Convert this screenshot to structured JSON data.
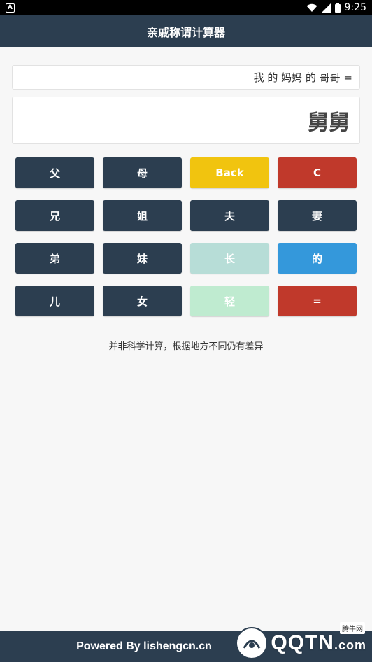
{
  "status_bar": {
    "notification_icon_letter": "A",
    "time": "9:25",
    "icons": [
      "wifi-icon",
      "signal-icon",
      "battery-icon"
    ]
  },
  "header": {
    "title": "亲戚称谓计算器"
  },
  "display": {
    "expression": "我 的 妈妈 的 哥哥 =",
    "result": "舅舅"
  },
  "keys": [
    {
      "label": "父",
      "color": "#2c3e50"
    },
    {
      "label": "母",
      "color": "#2c3e50"
    },
    {
      "label": "Back",
      "color": "#f1c40f"
    },
    {
      "label": "C",
      "color": "#c0392b"
    },
    {
      "label": "兄",
      "color": "#2c3e50"
    },
    {
      "label": "姐",
      "color": "#2c3e50"
    },
    {
      "label": "夫",
      "color": "#2c3e50"
    },
    {
      "label": "妻",
      "color": "#2c3e50"
    },
    {
      "label": "弟",
      "color": "#2c3e50"
    },
    {
      "label": "妹",
      "color": "#2c3e50"
    },
    {
      "label": "长",
      "color": "#b7ddd7"
    },
    {
      "label": "的",
      "color": "#3498db"
    },
    {
      "label": "儿",
      "color": "#2c3e50"
    },
    {
      "label": "女",
      "color": "#2c3e50"
    },
    {
      "label": "轻",
      "color": "#bfebd0"
    },
    {
      "label": "=",
      "color": "#c0392b"
    }
  ],
  "note": "并非科学计算，根据地方不同仍有差异",
  "footer": {
    "text": "Powered By lishengcn.cn"
  },
  "watermark": {
    "brand": "QQTN",
    "suffix": ".com",
    "tag": "腾牛网"
  },
  "colors": {
    "primary": "#2c3e50",
    "background": "#f7f7f7"
  }
}
